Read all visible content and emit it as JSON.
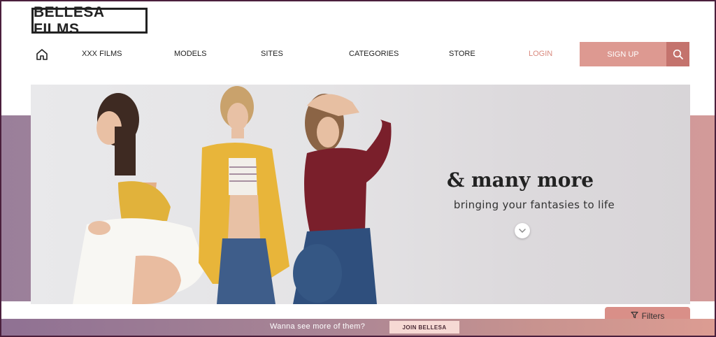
{
  "header": {
    "logo_text": "BELLESA FILMS"
  },
  "nav": {
    "home_icon": "home-icon",
    "items": [
      {
        "label": "XXX FILMS"
      },
      {
        "label": "MODELS"
      },
      {
        "label": "SITES"
      },
      {
        "label": "CATEGORIES"
      },
      {
        "label": "STORE"
      }
    ],
    "login_label": "LOGIN",
    "signup_label": "SIGN UP",
    "search_icon": "search-icon"
  },
  "hero": {
    "title": "& many more",
    "subtitle": "bringing your fantasies to life",
    "scroll_icon": "chevron-down-icon"
  },
  "filters": {
    "label": "Filters",
    "icon": "filter-icon"
  },
  "bottom_bar": {
    "text": "Wanna see more of them?",
    "button_label": "JOIN BELLESA"
  },
  "colors": {
    "accent": "#dd9991",
    "accent_dark": "#c4736d",
    "login": "#d9897e"
  }
}
